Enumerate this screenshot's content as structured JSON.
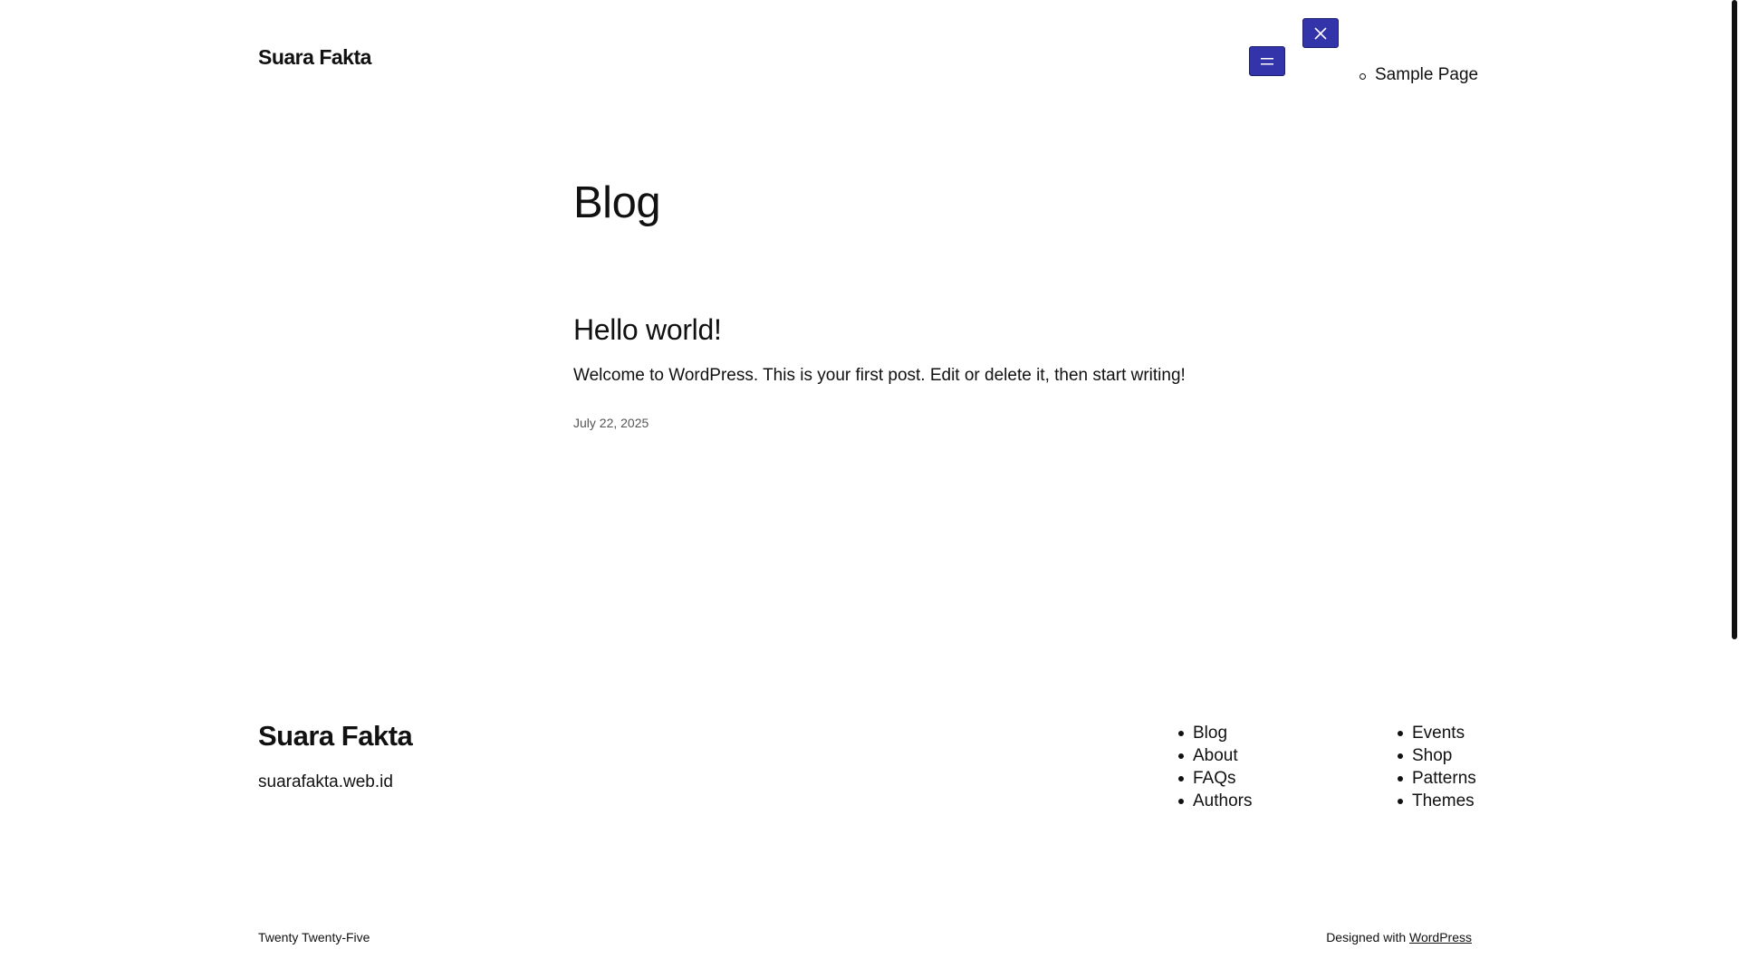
{
  "header": {
    "site_title": "Suara Fakta",
    "open_menu_icon": "menu-icon",
    "close_menu_icon": "close-icon",
    "nav_items": [
      {
        "label": "Sample Page"
      }
    ],
    "accent_color": "#3333aa"
  },
  "main": {
    "heading": "Blog",
    "posts": [
      {
        "title": "Hello world!",
        "excerpt": "Welcome to WordPress. This is your first post. Edit or delete it, then start writing!",
        "date": "July 22, 2025"
      }
    ]
  },
  "footer": {
    "site_title": "Suara Fakta",
    "tagline": "suarafakta.web.id",
    "menu_1": [
      "Blog",
      "About",
      "FAQs",
      "Authors"
    ],
    "menu_2": [
      "Events",
      "Shop",
      "Patterns",
      "Themes"
    ],
    "theme_credit": "Twenty Twenty-Five",
    "designed_with": "Designed with",
    "designed_with_link": "WordPress"
  }
}
